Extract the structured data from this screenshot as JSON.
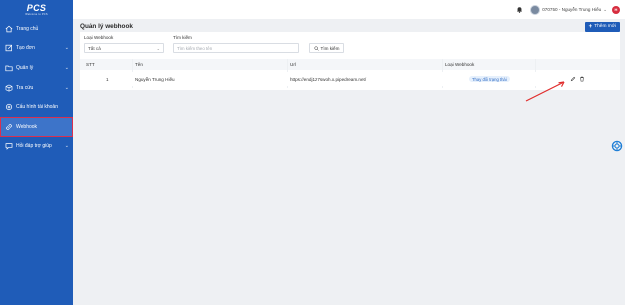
{
  "brand": {
    "logo_text": "PCS",
    "tagline": "Welcome to PCS"
  },
  "sidebar": {
    "items": [
      {
        "label": "Trang chủ",
        "icon": "home-icon",
        "has_children": false
      },
      {
        "label": "Tạo đơn",
        "icon": "edit-icon",
        "has_children": true
      },
      {
        "label": "Quản lý",
        "icon": "folder-icon",
        "has_children": true
      },
      {
        "label": "Tra cứu",
        "icon": "box-icon",
        "has_children": true
      },
      {
        "label": "Cấu hình tài khoản",
        "icon": "gear-icon",
        "has_children": false
      },
      {
        "label": "Webhook",
        "icon": "link-icon",
        "has_children": false,
        "active": true
      },
      {
        "label": "Hỏi đáp trợ giúp",
        "icon": "help-icon",
        "has_children": true
      }
    ],
    "chevron": "⌄"
  },
  "topbar": {
    "user_display": "070750 - Nguyễn Trung Hiếu",
    "user_chevron": "⌄",
    "badge": "H"
  },
  "page": {
    "title": "Quản lý webhook",
    "add_button": "Thêm mới",
    "add_plus": "+"
  },
  "filters": {
    "type_label": "Loại Webhook",
    "type_value": "Tất cả",
    "type_chevron": "⌄",
    "search_label": "Tìm kiếm",
    "search_placeholder": "Tìm kiếm theo tên",
    "search_button": "Tìm kiếm"
  },
  "table": {
    "columns": [
      "STT",
      "Tên",
      "Url",
      "Loại Webhook"
    ],
    "rows": [
      {
        "stt": "1",
        "name": "Nguyễn Trung Hiếu",
        "url": "https://endj1z7swoh.x.pipedream.net/",
        "status_action": "Thay đổi trạng thái"
      }
    ]
  },
  "colors": {
    "sidebar_bg": "#1f5cb8",
    "primary": "#1f5cb8",
    "active_outline": "#d9304f",
    "annotation_arrow": "#e02d2d"
  }
}
